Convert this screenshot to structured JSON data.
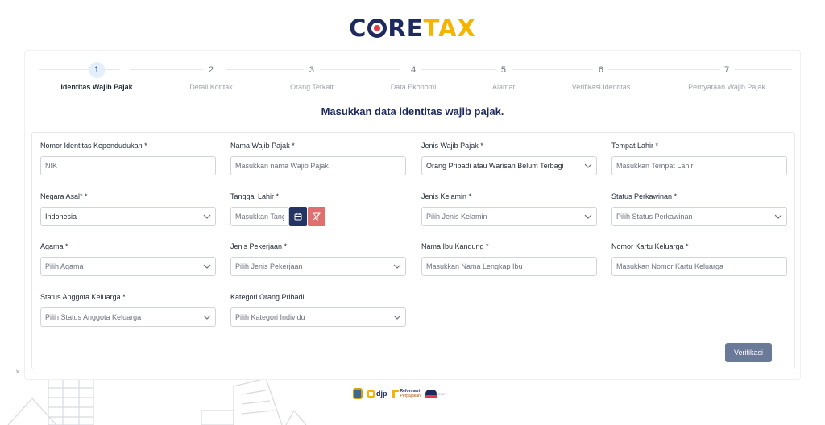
{
  "brand": {
    "part1": "C",
    "part2": "RE",
    "part3": "TAX"
  },
  "stepper": [
    {
      "num": "1",
      "label": "Identitas Wajib Pajak",
      "active": true
    },
    {
      "num": "2",
      "label": "Detail Kontak",
      "active": false
    },
    {
      "num": "3",
      "label": "Orang Terkait",
      "active": false
    },
    {
      "num": "4",
      "label": "Data Ekonomi",
      "active": false
    },
    {
      "num": "5",
      "label": "Alamat",
      "active": false
    },
    {
      "num": "6",
      "label": "Verifikasi Identitas",
      "active": false
    },
    {
      "num": "7",
      "label": "Pernyataan Wajib Pajak",
      "active": false
    }
  ],
  "subtitle": "Masukkan data identitas wajib pajak.",
  "form": {
    "nik": {
      "label": "Nomor Identitas Kependudukan *",
      "placeholder": "NIK"
    },
    "nama": {
      "label": "Nama Wajib Pajak *",
      "placeholder": "Masukkan nama Wajib Pajak"
    },
    "jenis_wp": {
      "label": "Jenis Wajib Pajak *",
      "value": "Orang Pribadi atau Warisan Belum Terbagi"
    },
    "tempat_lahir": {
      "label": "Tempat Lahir *",
      "placeholder": "Masukkan Tempat Lahir"
    },
    "negara": {
      "label": "Negara Asal* *",
      "value": "Indonesia"
    },
    "tanggal_lahir": {
      "label": "Tanggal Lahir *",
      "placeholder": "Masukkan Tanggal Lahir"
    },
    "jenis_kelamin": {
      "label": "Jenis Kelamin *",
      "value": "Pilih Jenis Kelamin"
    },
    "status_kawin": {
      "label": "Status Perkawinan *",
      "value": "Pilih Status Perkawinan"
    },
    "agama": {
      "label": "Agama *",
      "value": "Pilih Agama"
    },
    "pekerjaan": {
      "label": "Jenis Pekerjaan *",
      "value": "Pilih Jenis Pekerjaan"
    },
    "ibu": {
      "label": "Nama Ibu Kandung *",
      "placeholder": "Masukkan Nama Lengkap Ibu"
    },
    "kk": {
      "label": "Nomor Kartu Keluarga *",
      "placeholder": "Masukkan Nomor Kartu Keluarga"
    },
    "status_keluarga": {
      "label": "Status Anggota Keluarga *",
      "value": "Pilih Status Anggota Keluarga"
    },
    "kategori": {
      "label": "Kategori Orang Pribadi",
      "value": "Pilih Kategori Individu"
    }
  },
  "verify_label": "Verifikasi",
  "close_glyph": "×",
  "footer": {
    "djp": "djp",
    "reformasi_1": "Reformasi",
    "reformasi_2": "Perpajakan",
    "siap": "SIAP"
  },
  "colors": {
    "navy": "#1e2a5e",
    "gold": "#f4b400",
    "red": "#e63946",
    "button": "#6c7a99"
  },
  "icons": {
    "calendar": "calendar-icon",
    "clear": "filter-clear-icon",
    "chevron": "chevron-down-icon"
  }
}
